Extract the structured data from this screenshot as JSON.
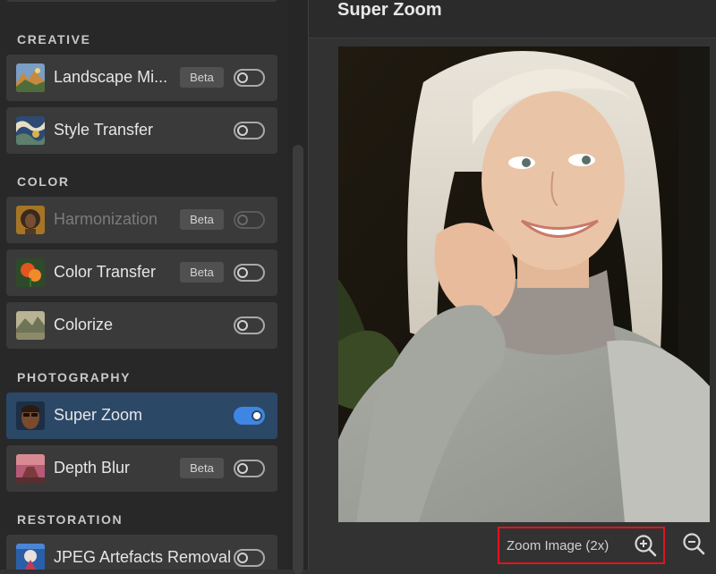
{
  "left_panel": {
    "sections": [
      {
        "title": "CREATIVE",
        "items": [
          {
            "label": "Landscape Mi...",
            "badge": "Beta",
            "toggle": "off",
            "thumb": "landscape-thumb"
          },
          {
            "label": "Style Transfer",
            "badge": "",
            "toggle": "off",
            "thumb": "style-transfer-thumb"
          }
        ]
      },
      {
        "title": "COLOR",
        "items": [
          {
            "label": "Harmonization",
            "badge": "Beta",
            "toggle": "off-disabled",
            "thumb": "harmonization-thumb"
          },
          {
            "label": "Color Transfer",
            "badge": "Beta",
            "toggle": "off",
            "thumb": "color-transfer-thumb"
          },
          {
            "label": "Colorize",
            "badge": "",
            "toggle": "off",
            "thumb": "colorize-thumb"
          }
        ]
      },
      {
        "title": "PHOTOGRAPHY",
        "items": [
          {
            "label": "Super Zoom",
            "badge": "",
            "toggle": "on",
            "thumb": "super-zoom-thumb"
          },
          {
            "label": "Depth Blur",
            "badge": "Beta",
            "toggle": "off",
            "thumb": "depth-blur-thumb"
          }
        ]
      },
      {
        "title": "RESTORATION",
        "items": [
          {
            "label": "JPEG Artefacts Removal",
            "badge": "",
            "toggle": "off",
            "thumb": "jpeg-artefacts-thumb"
          }
        ]
      }
    ]
  },
  "preview": {
    "title": "Super Zoom",
    "image": "portrait-photo",
    "zoom_in_label": "Zoom Image (2x)",
    "zoom_in_icon": "zoom-in-icon",
    "zoom_out_icon": "zoom-out-icon"
  },
  "colors": {
    "active_item": "#2c4867",
    "toggle_on": "#3f86e4",
    "highlight_box": "#e0141e"
  }
}
